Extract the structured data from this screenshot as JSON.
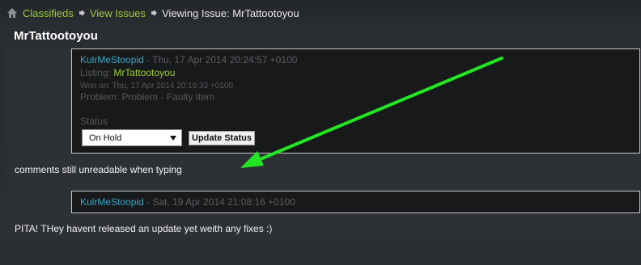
{
  "breadcrumb": {
    "home_icon": "home-icon",
    "items": [
      "Classifieds",
      "View Issues"
    ],
    "current": "Viewing Issue: MrTattootoyou"
  },
  "issue": {
    "title": "MrTattootoyou"
  },
  "comment1": {
    "author": "KulrMeStoopid",
    "date": " - Thu, 17 Apr 2014 20:24:57 +0100",
    "listing_label": "Listing: ",
    "listing_value": "MrTattootoyou",
    "won_on": "Won on: Thu, 17 Apr 2014 20:19:33 +0100",
    "problem": "Problem: Problem - Faulty Item",
    "status_label": "Status",
    "status_value": "On Hold",
    "update_button": "Update Status",
    "body": "comments still unreadable when typing"
  },
  "comment2": {
    "author": "KulrMeStoopid",
    "date": " - Sat, 19 Apr 2014 21:08:16 +0100",
    "body": "PITA! THey havent released an update yet weith any fixes :)"
  },
  "colors": {
    "link_green": "#9ccc3a",
    "author_blue": "#3aa8c4",
    "annotation_arrow": "#22e622"
  }
}
